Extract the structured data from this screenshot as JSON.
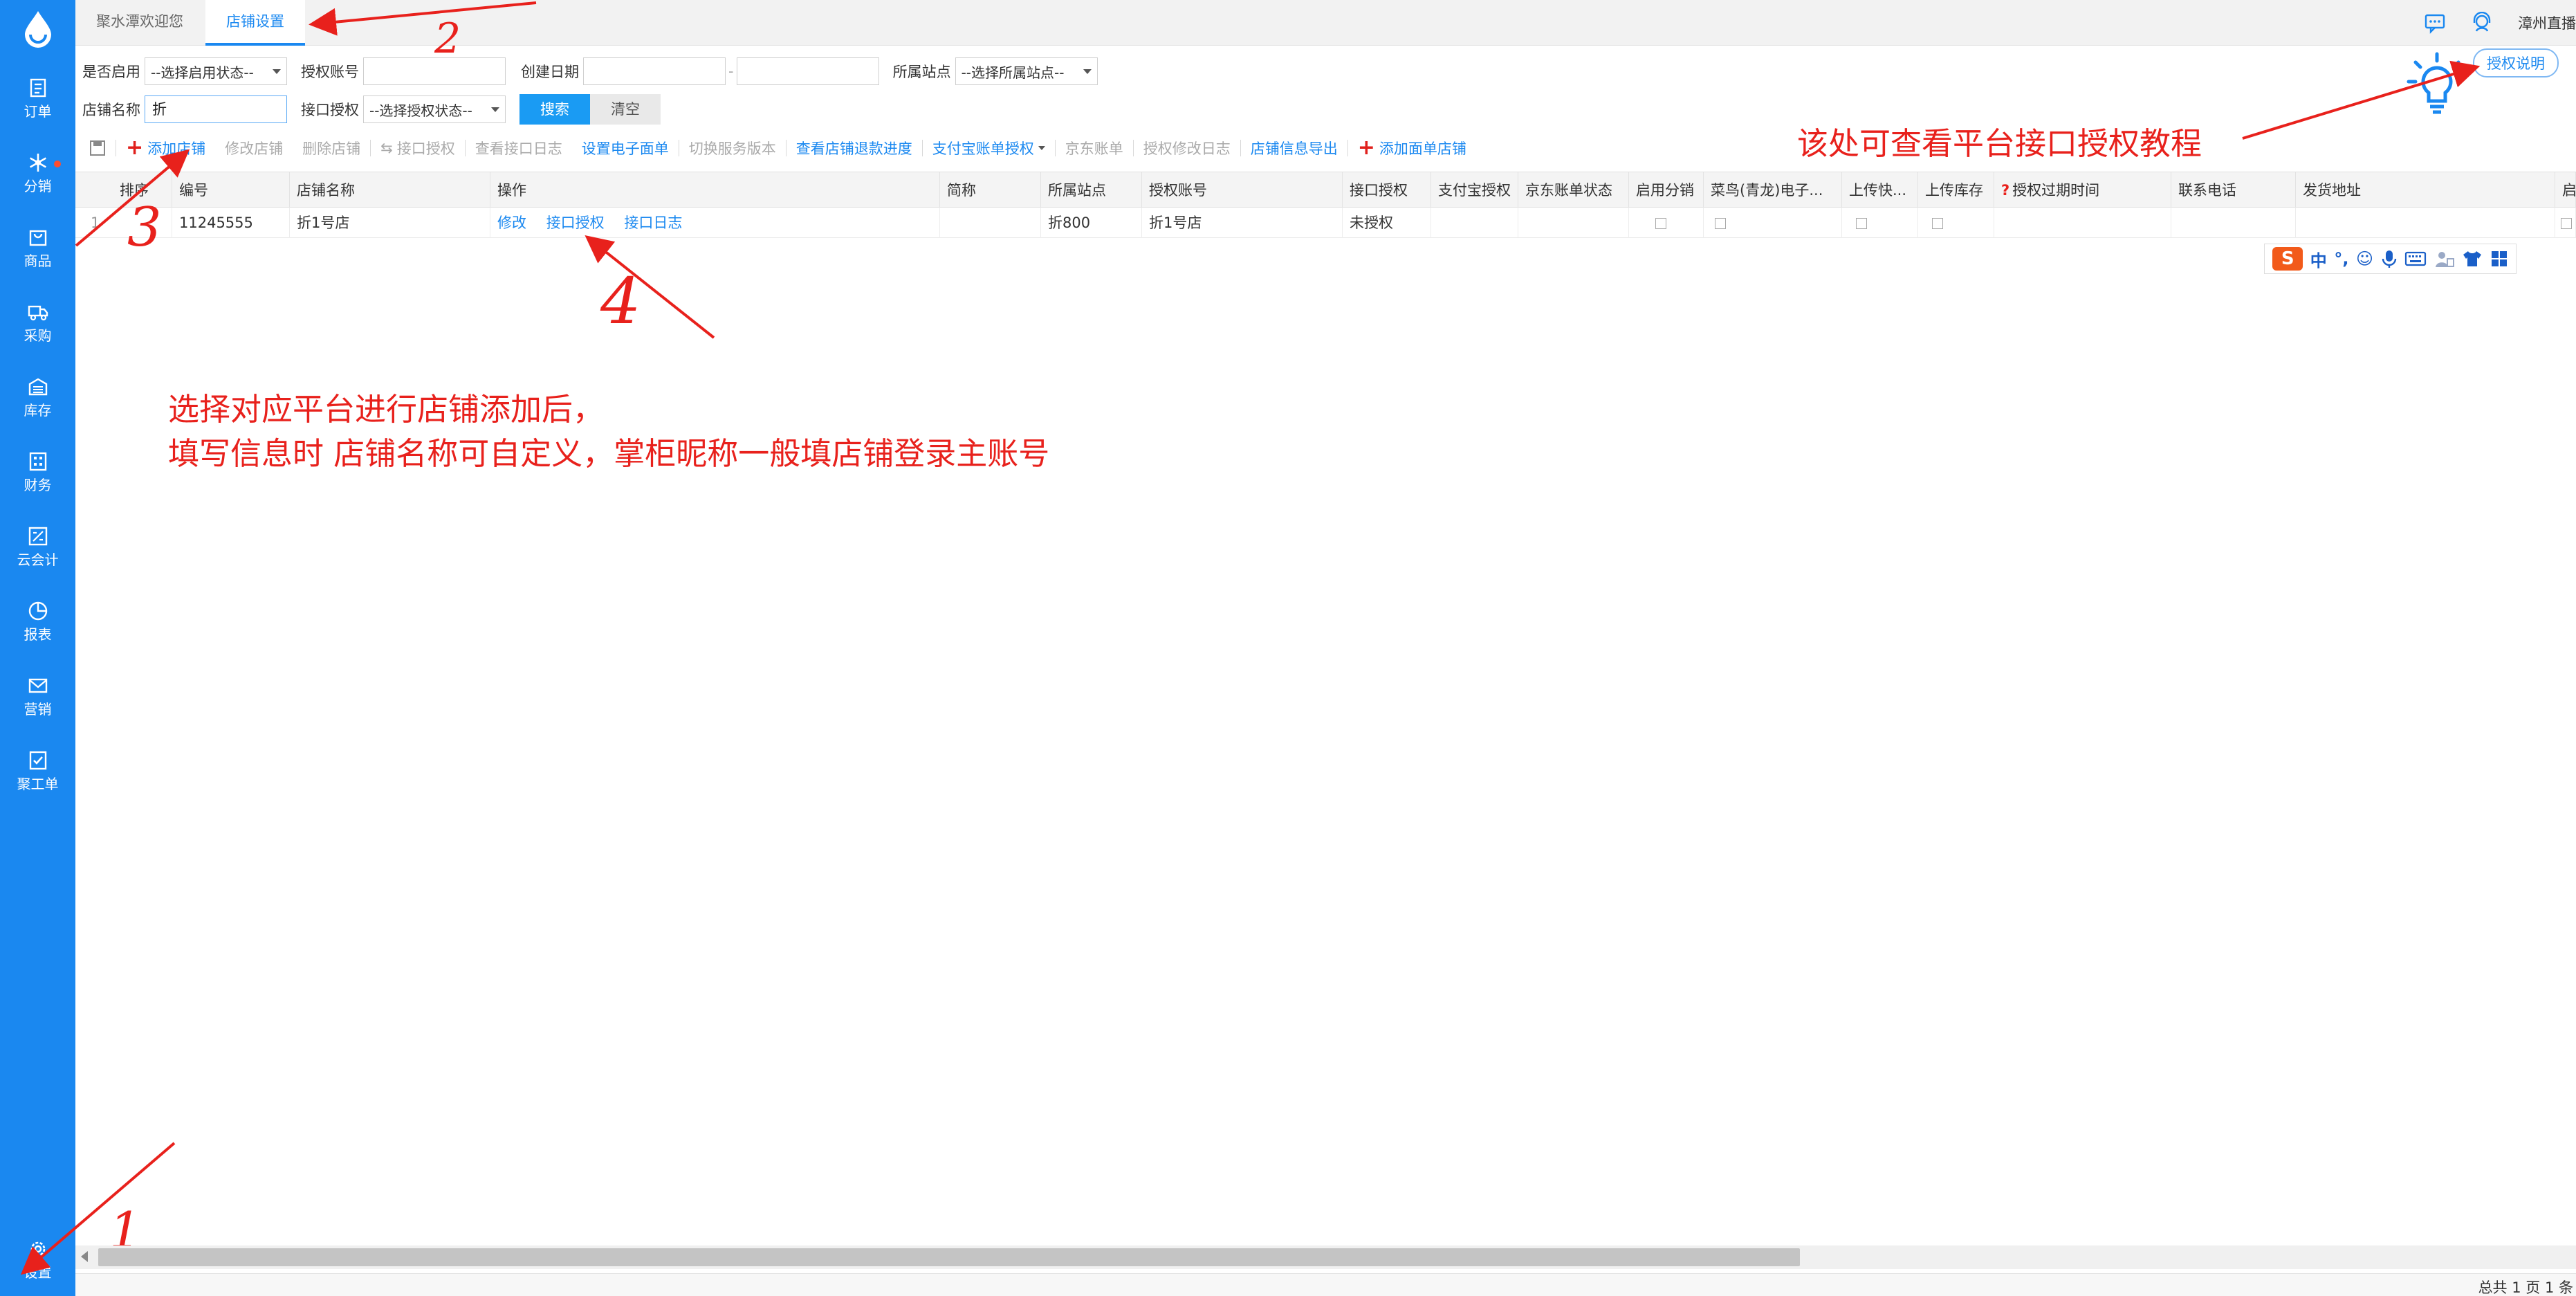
{
  "sidebar": {
    "items": [
      {
        "label": "订单",
        "icon": "order-icon"
      },
      {
        "label": "分销",
        "icon": "snowflake-icon"
      },
      {
        "label": "商品",
        "icon": "bag-icon"
      },
      {
        "label": "采购",
        "icon": "truck-icon"
      },
      {
        "label": "库存",
        "icon": "warehouse-icon"
      },
      {
        "label": "财务",
        "icon": "calculator-icon"
      },
      {
        "label": "云会计",
        "icon": "ledger-icon"
      },
      {
        "label": "报表",
        "icon": "pie-icon"
      },
      {
        "label": "营销",
        "icon": "mail-icon"
      },
      {
        "label": "聚工单",
        "icon": "checklist-icon"
      }
    ],
    "settings_label": "设置",
    "accent": "#1a88f0",
    "badge_color": "#ff4d2e"
  },
  "tabs": [
    {
      "label": "聚水潭欢迎您"
    },
    {
      "label": "店铺设置"
    }
  ],
  "topbar": {
    "user": "漳州直播"
  },
  "filters": {
    "enable_label": "是否启用",
    "enable_select": "--选择启用状态--",
    "auth_account_label": "授权账号",
    "auth_account_value": "",
    "created_label": "创建日期",
    "date_sep": "-",
    "site_label": "所属站点",
    "site_select": "--选择所属站点--",
    "shop_name_label": "店铺名称",
    "shop_name_value": "折",
    "api_auth_label": "接口授权",
    "api_auth_select": "--选择授权状态--",
    "search_btn": "搜索",
    "clear_btn": "清空"
  },
  "toolbar": {
    "add_shop": "添加店铺",
    "edit_shop": "修改店铺",
    "delete_shop": "删除店铺",
    "api_auth": "接口授权",
    "api_log": "查看接口日志",
    "set_eface": "设置电子面单",
    "switch_version": "切换服务版本",
    "refund_progress": "查看店铺退款进度",
    "alipay_auth": "支付宝账单授权",
    "jd_bill": "京东账单",
    "auth_log": "授权修改日志",
    "export": "店铺信息导出",
    "add_face_shop": "添加面单店铺"
  },
  "table": {
    "headers": [
      "排序",
      "编号",
      "店铺名称",
      "操作",
      "简称",
      "所属站点",
      "授权账号",
      "接口授权",
      "支付宝授权",
      "京东账单状态",
      "启用分销",
      "菜鸟(青龙)电子...",
      "上传快...",
      "上传库存",
      "授权过期时间",
      "联系电话",
      "发货地址",
      "启用"
    ],
    "help_mark": "?",
    "rows": [
      {
        "order": "1",
        "id": "11245555",
        "name": "折1号店",
        "actions": [
          "修改",
          "接口授权",
          "接口日志"
        ],
        "short": "",
        "site": "折800",
        "account": "折1号店",
        "api_status": "未授权"
      }
    ]
  },
  "hint": {
    "button": "授权说明"
  },
  "ime": {
    "logo": "S",
    "mode": "中"
  },
  "annotations": {
    "main_line1": "选择对应平台进行店铺添加后，",
    "main_line2": "填写信息时 店铺名称可自定义，掌柜昵称一般填店铺登录主账号",
    "hint_note": "该处可查看平台接口授权教程",
    "n1": "1",
    "n2": "2",
    "n3": "3",
    "n4": "4",
    "color": "#e8211c"
  },
  "footer": {
    "page_info": "总共 1 页 1 条"
  }
}
